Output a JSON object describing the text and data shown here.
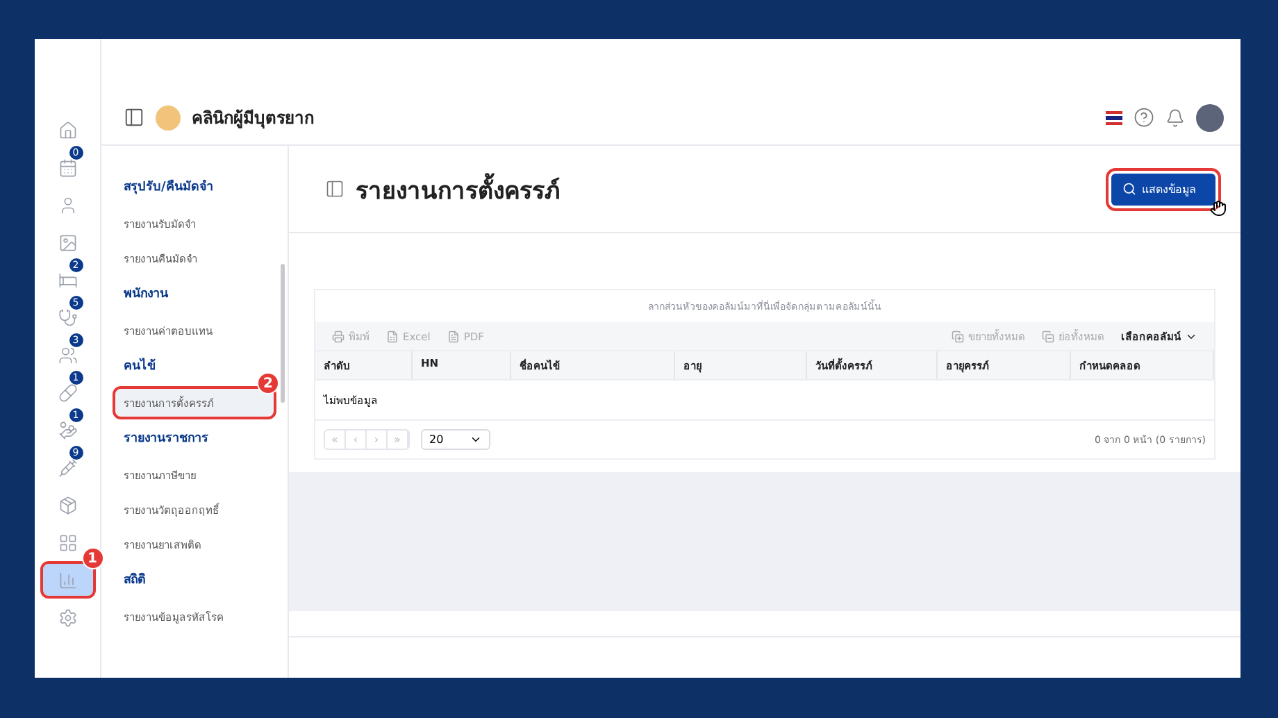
{
  "rail": [
    {
      "kind": "home",
      "selected": false
    },
    {
      "kind": "calendar",
      "badge": "0",
      "selected": false
    },
    {
      "kind": "user",
      "selected": false
    },
    {
      "kind": "image",
      "selected": false
    },
    {
      "kind": "bed",
      "badge": "2",
      "selected": false
    },
    {
      "kind": "stethoscope",
      "badge": "5",
      "selected": false
    },
    {
      "kind": "users",
      "badge": "3",
      "selected": false
    },
    {
      "kind": "pill",
      "badge": "1",
      "selected": false
    },
    {
      "kind": "hand",
      "badge": "1",
      "selected": false
    },
    {
      "kind": "syringe",
      "badge": "9",
      "selected": false
    },
    {
      "kind": "package",
      "selected": false
    },
    {
      "kind": "grid",
      "selected": false
    },
    {
      "kind": "chart",
      "selected": true,
      "callout": "1"
    },
    {
      "kind": "settings",
      "selected": false
    }
  ],
  "header": {
    "clinic_name": "คลินิกผู้มีบุตรยาก"
  },
  "menu": [
    {
      "title": "สรุปรับ/คืนมัดจำ",
      "items": [
        {
          "label": "รายงานรับมัดจำ",
          "selected": false
        },
        {
          "label": "รายงานคืนมัดจำ",
          "selected": false
        }
      ]
    },
    {
      "title": "พนักงาน",
      "items": [
        {
          "label": "รายงานค่าตอบแทน",
          "selected": false
        }
      ]
    },
    {
      "title": "คนไข้",
      "items": [
        {
          "label": "รายงานการตั้งครรภ์",
          "selected": true,
          "callout": "2"
        }
      ]
    },
    {
      "title": "รายงานราชการ",
      "items": [
        {
          "label": "รายงานภาษีขาย",
          "selected": false
        },
        {
          "label": "รายงานวัตถุออกฤทธิ์",
          "selected": false
        },
        {
          "label": "รายงานยาเสพติด",
          "selected": false
        }
      ]
    },
    {
      "title": "สถิติ",
      "items": [
        {
          "label": "รายงานข้อมูลรหัสโรค",
          "selected": false
        }
      ]
    }
  ],
  "page": {
    "title": "รายงานการตั้งครรภ์",
    "show_button": "แสดงข้อมูล"
  },
  "table": {
    "group_hint": "ลากส่วนหัวของคอลัมน์มาที่นี่เพื่อจัดกลุ่มตามคอลัมน์นั้น",
    "tools_left": [
      "พิมพ์",
      "Excel",
      "PDF"
    ],
    "expand_all": "ขยายทั้งหมด",
    "collapse_all": "ย่อทั้งหมด",
    "choose_columns": "เลือกคอลัมน์",
    "columns": [
      "ลำดับ",
      "HN",
      "ชื่อคนไข้",
      "อายุ",
      "วันที่ตั้งครรภ์",
      "อายุครรภ์",
      "กำหนดคลอด"
    ],
    "empty": "ไม่พบข้อมูล",
    "pager": [
      "«",
      "‹",
      "›",
      "»"
    ],
    "page_size": "20",
    "summary": "0 จาก 0 หน้า (0 รายการ)"
  }
}
